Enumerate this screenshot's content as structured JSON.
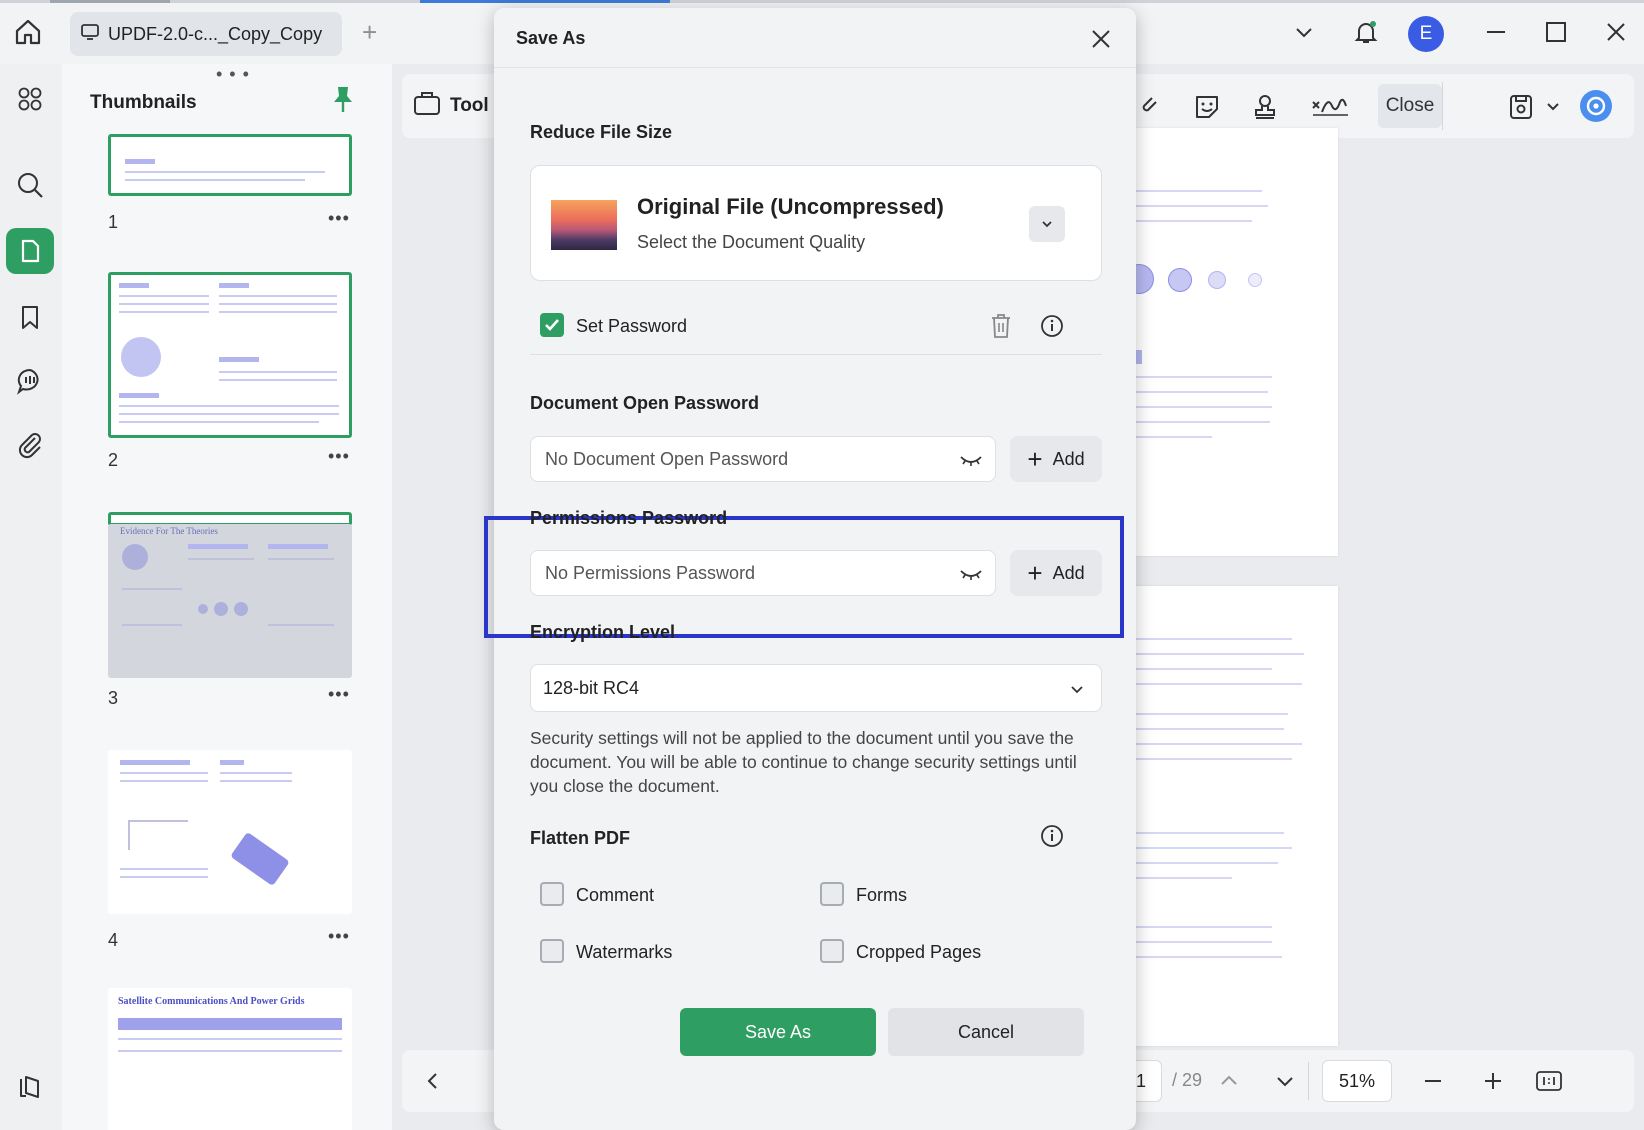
{
  "tab": {
    "title": "UPDF-2.0-c..._Copy_Copy"
  },
  "user": {
    "avatar_letter": "E"
  },
  "thumbnails": {
    "title": "Thumbnails",
    "pages": [
      {
        "number": "1"
      },
      {
        "number": "2"
      },
      {
        "number": "3"
      },
      {
        "number": "4"
      }
    ],
    "page5_heading": "Satellite Communications And Power Grids",
    "page3_heading": "Evidence For The Theories"
  },
  "toolbar": {
    "tools_label": "Tool",
    "close_label": "Close"
  },
  "navigation": {
    "current_page": "1",
    "total_pages": "/ 29",
    "zoom": "51%"
  },
  "dialog": {
    "title": "Save As",
    "reduce_file_size": {
      "heading": "Reduce File Size",
      "option_title": "Original File (Uncompressed)",
      "option_subtitle": "Select the Document Quality"
    },
    "set_password": {
      "label": "Set Password",
      "checked": true
    },
    "open_password": {
      "heading": "Document Open Password",
      "placeholder": "No Document Open Password",
      "add_label": "Add"
    },
    "permissions_password": {
      "heading": "Permissions Password",
      "placeholder": "No Permissions Password",
      "add_label": "Add"
    },
    "encryption": {
      "heading": "Encryption Level",
      "value": "128-bit RC4"
    },
    "note": "Security settings will not be applied to the document until you save the document. You will be able to continue to change security settings until you close the document.",
    "flatten": {
      "heading": "Flatten PDF",
      "options": {
        "comment": "Comment",
        "forms": "Forms",
        "watermarks": "Watermarks",
        "cropped_pages": "Cropped Pages"
      }
    },
    "save_label": "Save As",
    "cancel_label": "Cancel"
  },
  "colors": {
    "accent": "#2f9e62",
    "highlight": "#2a36c9",
    "avatar": "#3a5ce4"
  }
}
